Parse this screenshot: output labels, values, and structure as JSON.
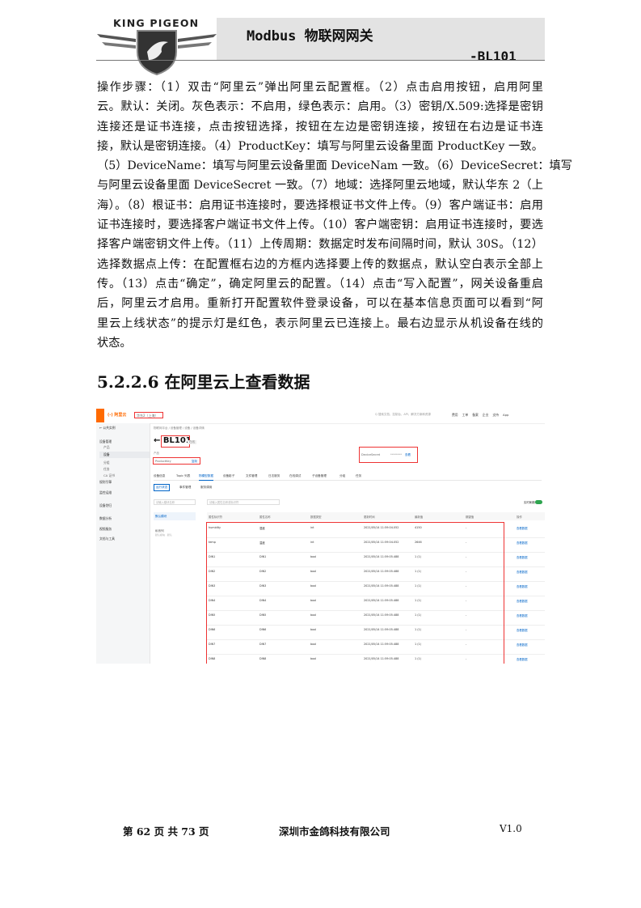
{
  "header": {
    "logo_text": "KING PIGEON",
    "title": "Modbus 物联网网关",
    "model": "-BL101"
  },
  "paragraph_lines": [
    "操作步骤：（1）双击“阿里云”弹出阿里云配置框。（2）点击启用按钮，启用阿里",
    "云。默认：关闭。灰色表示：不启用，绿色表示：启用。（3）密钥/X.509:选择是密钥",
    "连接还是证书连接，点击按钮选择，按钮在左边是密钥连接，按钮在右边是证书连",
    "接，默认是密钥连接。（4）ProductKey：填写与阿里云设备里面 ProductKey 一致。",
    "（5）DeviceName：填写与阿里云设备里面 DeviceNam 一致。（6）DeviceSecret：填写",
    "与阿里云设备里面 DeviceSecret 一致。（7）地域：选择阿里云地域，默认华东 2（上",
    "海）。（8）根证书：启用证书连接时，要选择根证书文件上传。（9）客户端证书：启用",
    "证书连接时，要选择客户端证书文件上传。（10）客户端密钥：启用证书连接时，要选",
    "择客户端密钥文件上传。（11）上传周期：数据定时发布间隔时间，默认 30S。（12）",
    "选择数据点上传：在配置框右边的方框内选择要上传的数据点，默认空白表示全部上",
    "传。（13）点击“确定”，确定阿里云的配置。（14）点击“写入配置”，网关设备重启",
    "后，阿里云才启用。重新打开配置软件登录设备，可以在基本信息页面可以看到“阿",
    "里云上线状态”的提示灯是红色，表示阿里云已连接上。最右边显示从机设备在线的",
    "状态。"
  ],
  "section_title": "5.2.2.6 在阿里云上查看数据",
  "screenshot": {
    "brand": "(-) 阿里云",
    "region": "华东2（上海）",
    "search_placeholder": "Q 搜索文档、控制台、API、解决方案和资源",
    "top_links": [
      "费用",
      "工单",
      "备案",
      "企业",
      "支持",
      "App"
    ],
    "sidebar": [
      {
        "label": "← 公共实例",
        "type": "item"
      },
      {
        "label": "设备管理",
        "type": "item"
      },
      {
        "label": "产品",
        "type": "sub"
      },
      {
        "label": "设备",
        "type": "active"
      },
      {
        "label": "分组",
        "type": "sub"
      },
      {
        "label": "任务",
        "type": "sub"
      },
      {
        "label": "CA 证书",
        "type": "sub"
      },
      {
        "label": "规则引擎",
        "type": "item"
      },
      {
        "label": "监控运维",
        "type": "item"
      },
      {
        "label": "设备划归",
        "type": "item"
      },
      {
        "label": "数据分析",
        "type": "item"
      },
      {
        "label": "视频服务",
        "type": "item"
      },
      {
        "label": "文档与工具",
        "type": "item"
      }
    ],
    "breadcrumb": "物联网平台 / 设备管理 / 设备 / 设备详情",
    "device_title": "← BL101",
    "online_badge": "在线",
    "product_label": "产品",
    "product_key_label": "ProductKey",
    "copy_label": "复制",
    "view_label": "查看",
    "device_secret_label": "DeviceSecret",
    "device_secret_mask": "********",
    "tabs": [
      "设备信息",
      "Topic 列表",
      "物模型数据",
      "设备影子",
      "文件管理",
      "日志服务",
      "在线调试",
      "子设备管理",
      "分组",
      "任务"
    ],
    "active_tab": "物模型数据",
    "subtabs": [
      "运行状态",
      "事件管理",
      "服务调用"
    ],
    "left_search_placeholder": "请输入模块名称",
    "right_search_placeholder": "请输入属性名称或标识符",
    "realtime_label": "实时刷新",
    "groups": [
      "默认模块",
      "私系列",
      "默认模块 · 默认"
    ],
    "columns": [
      "属性标识符",
      "属性名称",
      "数据类型",
      "更新时间",
      "最新值",
      "期望值",
      "操作"
    ],
    "rows": [
      {
        "id": "humidity",
        "name": "湿度",
        "type": "int",
        "time": "2021/05/14 11:59:04.052",
        "value": "4150",
        "expected": "-",
        "op": "查看数据"
      },
      {
        "id": "temp",
        "name": "温度",
        "type": "int",
        "time": "2021/05/14 11:59:04.052",
        "value": "2646",
        "expected": "-",
        "op": "查看数据"
      },
      {
        "id": "DIN1",
        "name": "DIN1",
        "type": "bool",
        "time": "2021/05/14 11:59:05.488",
        "value": "1 (1)",
        "expected": "-",
        "op": "查看数据"
      },
      {
        "id": "DIN2",
        "name": "DIN2",
        "type": "bool",
        "time": "2021/05/14 11:59:05.488",
        "value": "1 (1)",
        "expected": "-",
        "op": "查看数据"
      },
      {
        "id": "DIN3",
        "name": "DIN3",
        "type": "bool",
        "time": "2021/05/14 11:59:05.488",
        "value": "1 (1)",
        "expected": "-",
        "op": "查看数据"
      },
      {
        "id": "DIN4",
        "name": "DIN4",
        "type": "bool",
        "time": "2021/05/14 11:59:05.488",
        "value": "1 (1)",
        "expected": "-",
        "op": "查看数据"
      },
      {
        "id": "DIN5",
        "name": "DIN5",
        "type": "bool",
        "time": "2021/05/14 11:59:05.488",
        "value": "1 (1)",
        "expected": "-",
        "op": "查看数据"
      },
      {
        "id": "DIN6",
        "name": "DIN6",
        "type": "bool",
        "time": "2021/05/14 11:59:05.488",
        "value": "1 (1)",
        "expected": "-",
        "op": "查看数据"
      },
      {
        "id": "DIN7",
        "name": "DIN7",
        "type": "bool",
        "time": "2021/05/14 11:59:05.488",
        "value": "1 (1)",
        "expected": "-",
        "op": "查看数据"
      },
      {
        "id": "DIN8",
        "name": "DIN8",
        "type": "bool",
        "time": "2021/05/14 11:59:05.488",
        "value": "1 (1)",
        "expected": "-",
        "op": "查看数据"
      }
    ]
  },
  "footer": {
    "page": "第 62 页 共 73 页",
    "company": "深圳市金鸽科技有限公司",
    "version": "V1.0"
  },
  "colors": {
    "accent": "#ff6a00",
    "highlight": "#e33333",
    "link": "#0064c8"
  }
}
